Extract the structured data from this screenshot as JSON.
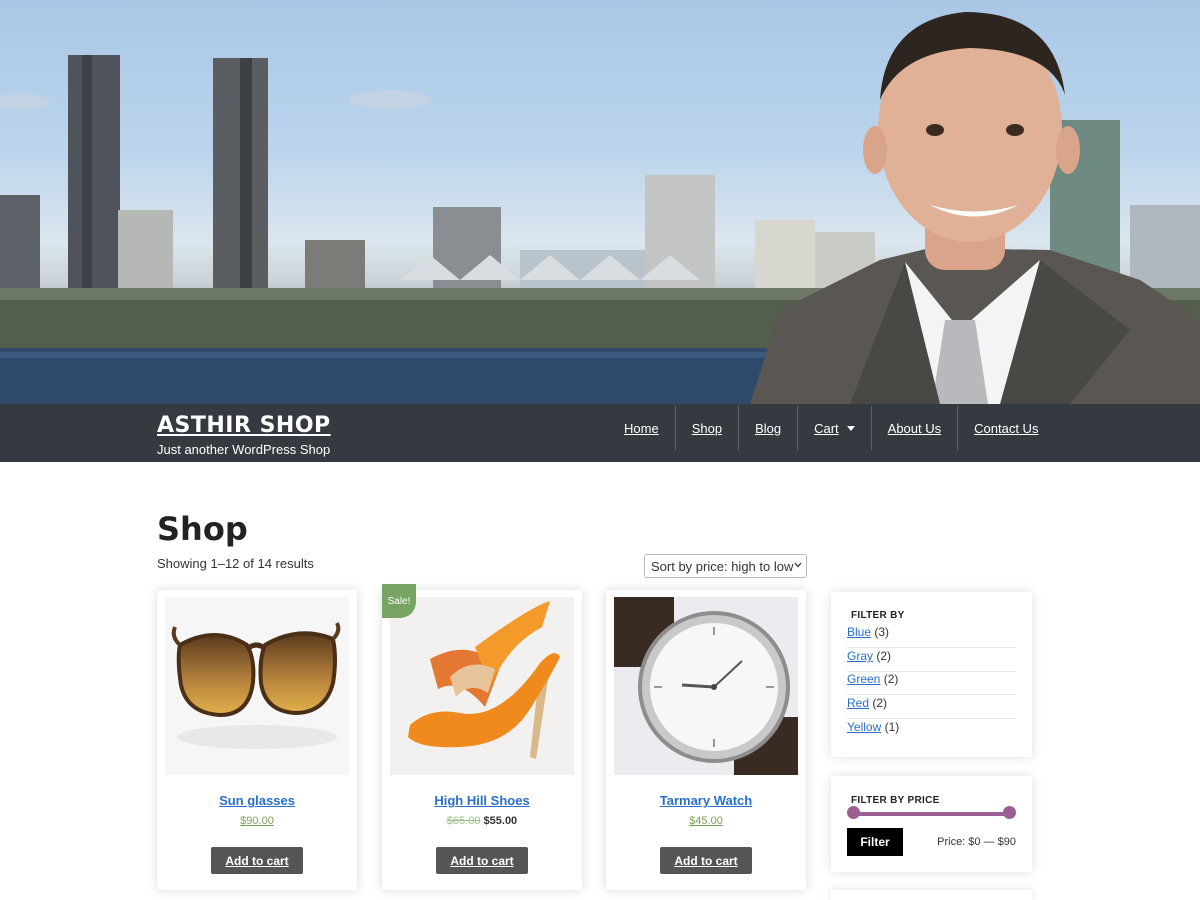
{
  "site": {
    "title": "ASTHIR SHOP",
    "tagline": "Just another WordPress Shop"
  },
  "nav": {
    "items": [
      {
        "label": "Home"
      },
      {
        "label": "Shop"
      },
      {
        "label": "Blog"
      },
      {
        "label": "Cart",
        "has_submenu": true
      },
      {
        "label": "About Us"
      },
      {
        "label": "Contact Us"
      }
    ]
  },
  "main": {
    "title": "Shop",
    "result_count": "Showing 1–12 of 14 results",
    "sort": {
      "selected": "Sort by price: high to low"
    }
  },
  "products": [
    {
      "name": "Sun glasses",
      "price": "$90.00",
      "button": "Add to cart",
      "image_icon": "sunglasses-icon"
    },
    {
      "name": "High Hill Shoes",
      "old_price": "$65.00",
      "price": "$55.00",
      "badge": "Sale!",
      "button": "Add to cart",
      "image_icon": "high-heel-shoe-icon"
    },
    {
      "name": "Tarmary Watch",
      "price": "$45.00",
      "button": "Add to cart",
      "image_icon": "wristwatch-icon"
    }
  ],
  "sidebar": {
    "filter_by": {
      "title": "FILTER BY",
      "items": [
        {
          "label": "Blue",
          "count": "(3)"
        },
        {
          "label": "Gray",
          "count": "(2)"
        },
        {
          "label": "Green",
          "count": "(2)"
        },
        {
          "label": "Red",
          "count": "(2)"
        },
        {
          "label": "Yellow",
          "count": "(1)"
        }
      ]
    },
    "filter_by_price": {
      "title": "FILTER BY PRICE",
      "button": "Filter",
      "range_text": "Price: $0 — $90"
    }
  },
  "colors": {
    "navbar": "#343a40",
    "link": "#2a6fc9",
    "sale_badge": "#77a464",
    "slider": "#9b5f93",
    "button": "#555555"
  }
}
